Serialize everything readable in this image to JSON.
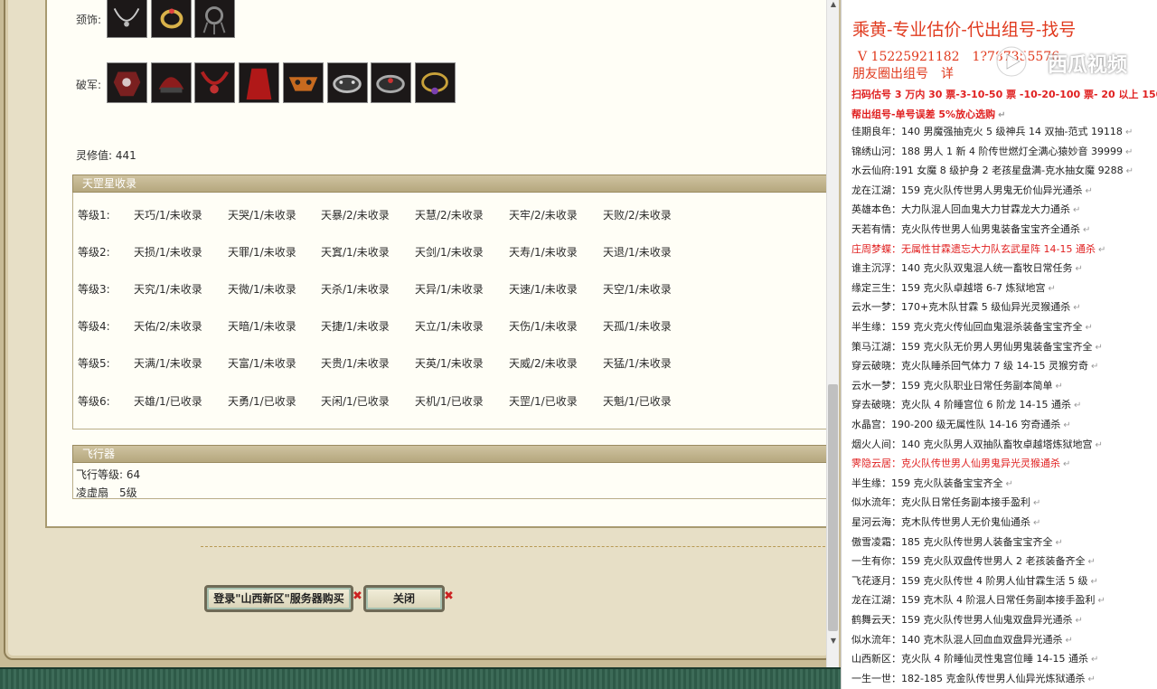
{
  "game": {
    "rows": {
      "accessory_label": "颈饰:",
      "pojun_label": "破军:"
    },
    "lingxiu": "灵修值: 441",
    "star_section": {
      "title": "天罡星收录",
      "levels": [
        {
          "label": "等级1:",
          "cells": [
            "天巧/1/未收录",
            "天哭/1/未收录",
            "天暴/2/未收录",
            "天慧/2/未收录",
            "天牢/2/未收录",
            "天败/2/未收录"
          ]
        },
        {
          "label": "等级2:",
          "cells": [
            "天损/1/未收录",
            "天罪/1/未收录",
            "天窴/1/未收录",
            "天剑/1/未收录",
            "天寿/1/未收录",
            "天退/1/未收录"
          ]
        },
        {
          "label": "等级3:",
          "cells": [
            "天究/1/未收录",
            "天微/1/未收录",
            "天杀/1/未收录",
            "天异/1/未收录",
            "天速/1/未收录",
            "天空/1/未收录"
          ]
        },
        {
          "label": "等级4:",
          "cells": [
            "天佑/2/未收录",
            "天暗/1/未收录",
            "天捷/1/未收录",
            "天立/1/未收录",
            "天伤/1/未收录",
            "天孤/1/未收录"
          ]
        },
        {
          "label": "等级5:",
          "cells": [
            "天满/1/未收录",
            "天富/1/未收录",
            "天贵/1/未收录",
            "天英/1/未收录",
            "天威/2/未收录",
            "天猛/1/未收录"
          ]
        },
        {
          "label": "等级6:",
          "cells": [
            "天雄/1/已收录",
            "天勇/1/已收录",
            "天闲/1/已收录",
            "天机/1/已收录",
            "天罡/1/已收录",
            "天魁/1/已收录"
          ]
        }
      ]
    },
    "flyer": {
      "title": "飞行器",
      "level": "飞行等级: 64",
      "item": "凌虚扇　5级"
    },
    "buttons": {
      "login": "登录\"山西新区\"服务器购买",
      "close": "关闭",
      "x_mark": "✖"
    }
  },
  "side": {
    "title": "乘黄-专业估价-代出组号-找号",
    "contact": "V 15225921182　1?787355576",
    "friend": "朋友圈出组号　详",
    "watermark": "西瓜视频",
    "promo1": "扫码估号 3 万内 30 票-3-10-50 票 -10-20-100 票- 20 以上 150",
    "promo2": "帮出组号-单号误差 5%放心选购",
    "para_mark": "↵",
    "items": [
      {
        "text": "佳期良年：140 男魔强抽克火 5 级神兵 14 双抽-范式 19118",
        "red": false
      },
      {
        "text": "锦绣山河：188 男人 1 新 4 阶传世燃灯全满心猿妙音 39999",
        "red": false
      },
      {
        "text": "水云仙府:191 女魔 8 级护身 2 老孩星盘满-克水抽女魔 9288",
        "red": false
      },
      {
        "text": "龙在江湖：159 克火队传世男人男鬼无价仙异光通杀",
        "red": false
      },
      {
        "text": "英雄本色：大力队混人回血鬼大力甘霖龙大力通杀",
        "red": false
      },
      {
        "text": "天若有情：克火队传世男人仙男鬼装备宝宝齐全通杀",
        "red": false
      },
      {
        "text": "庄周梦蝶：无属性甘霖遗忘大力队玄武星阵 14-15 通杀",
        "red": true
      },
      {
        "text": "谁主沉浮：140 克火队双鬼混人统一畜牧日常任务",
        "red": false
      },
      {
        "text": "缘定三生：159 克火队卓越塔 6-7 炼狱地宫",
        "red": false
      },
      {
        "text": "云水一梦：170+克木队甘霖 5 级仙异光灵猴通杀",
        "red": false
      },
      {
        "text": "半生缘：159 克火克火传仙回血鬼混杀装备宝宝齐全",
        "red": false
      },
      {
        "text": "策马江湖：159 克火队无价男人男仙男鬼装备宝宝齐全",
        "red": false
      },
      {
        "text": "穿云破晓：克火队睡杀回气体力 7 级 14-15 灵猴穷奇",
        "red": false
      },
      {
        "text": "云水一梦：159 克火队职业日常任务副本简单",
        "red": false
      },
      {
        "text": "穿去破晓：克火队 4 阶睡宫位 6 阶龙 14-15 通杀",
        "red": false
      },
      {
        "text": "水晶宫：190-200 级无属性队 14-16 穷奇通杀",
        "red": false
      },
      {
        "text": "烟火人间：140 克火队男人双抽队畜牧卓越塔炼狱地宫",
        "red": false
      },
      {
        "text": "霁隐云居：克火队传世男人仙男鬼异光灵猴通杀",
        "red": true
      },
      {
        "text": "半生缘：159 克火队装备宝宝齐全",
        "red": false
      },
      {
        "text": "似水流年：克火队日常任务副本接手盈利",
        "red": false
      },
      {
        "text": "星河云海：克木队传世男人无价鬼仙通杀",
        "red": false
      },
      {
        "text": "傲雪凌霜：185 克火队传世男人装备宝宝齐全",
        "red": false
      },
      {
        "text": "一生有你：159 克火队双盘传世男人 2 老孩装备齐全",
        "red": false
      },
      {
        "text": "飞花逐月：159 克火队传世 4 阶男人仙甘霖生活 5 级",
        "red": false
      },
      {
        "text": "龙在江湖：159 克木队 4 阶混人日常任务副本接手盈利",
        "red": false
      },
      {
        "text": "鹤舞云天：159 克火队传世男人仙鬼双盘异光通杀",
        "red": false
      },
      {
        "text": "似水流年：140 克木队混人回血血双盘异光通杀",
        "red": false
      },
      {
        "text": "山西新区：克火队 4 阶睡仙灵性鬼宫位睡 14-15 通杀",
        "red": false
      },
      {
        "text": "一生一世：182-185 克金队传世男人仙异光炼狱通杀",
        "red": false
      }
    ]
  },
  "colors": {
    "accent_red": "#e03a1e",
    "section_bar": "#b5a77e",
    "button_border": "#6f6a56"
  }
}
